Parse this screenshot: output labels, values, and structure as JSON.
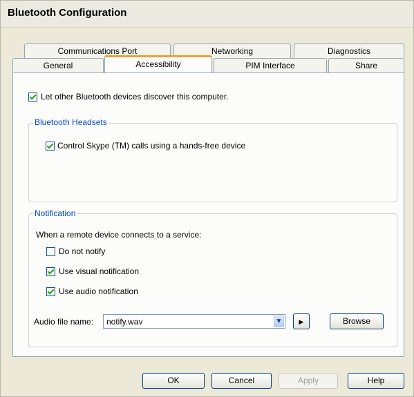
{
  "window": {
    "title": "Bluetooth Configuration"
  },
  "tabs": {
    "row1": [
      "Communications Port",
      "Networking",
      "Diagnostics"
    ],
    "row2": [
      "General",
      "Accessibility",
      "PIM Interface",
      "Share"
    ],
    "active": "Accessibility"
  },
  "discover": {
    "label": "Let other Bluetooth devices discover this computer.",
    "checked": true
  },
  "headsets": {
    "legend": "Bluetooth Headsets",
    "skype": {
      "label": "Control Skype (TM) calls using a hands-free device",
      "checked": true
    }
  },
  "notification": {
    "legend": "Notification",
    "prompt": "When a remote device connects to a service:",
    "options": [
      {
        "label": "Do not notify",
        "checked": false
      },
      {
        "label": "Use visual notification",
        "checked": true
      },
      {
        "label": "Use audio notification",
        "checked": true
      }
    ],
    "audio_label": "Audio file name:",
    "audio_value": "notify.wav",
    "browse_label": "Browse"
  },
  "buttons": {
    "ok": "OK",
    "cancel": "Cancel",
    "apply": "Apply",
    "help": "Help"
  }
}
